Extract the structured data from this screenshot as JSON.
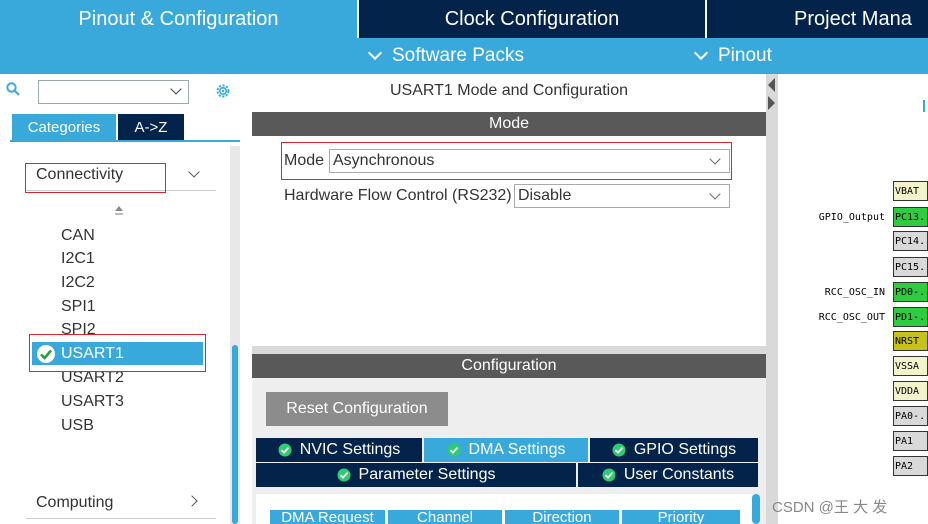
{
  "top_tabs": [
    {
      "label": "Pinout & Configuration"
    },
    {
      "label": "Clock Configuration"
    },
    {
      "label": "Project Mana"
    }
  ],
  "sub_bar": {
    "software_packs": "Software Packs",
    "pinout": "Pinout"
  },
  "left": {
    "search": {
      "value": "",
      "placeholder": ""
    },
    "tabs": {
      "categories": "Categories",
      "az": "A->Z"
    },
    "connectivity": "Connectivity",
    "items": [
      "CAN",
      "I2C1",
      "I2C2",
      "SPI1",
      "SPI2",
      "USART1",
      "USART2",
      "USART3",
      "USB"
    ],
    "selected_item": "USART1",
    "computing": "Computing"
  },
  "middle": {
    "title": "USART1 Mode and Configuration",
    "mode_header": "Mode",
    "mode_label": "Mode",
    "mode_value": "Asynchronous",
    "hfc_label": "Hardware Flow Control (RS232)",
    "hfc_value": "Disable",
    "config_header": "Configuration",
    "reset_button": "Reset Configuration",
    "settings_tabs": {
      "nvic": "NVIC Settings",
      "dma": "DMA Settings",
      "gpio": "GPIO Settings",
      "parameter": "Parameter Settings",
      "user_constants": "User Constants"
    },
    "active_tab": "DMA Settings",
    "table_headers": [
      "DMA Request",
      "Channel",
      "Direction",
      "Priority"
    ]
  },
  "pinout": {
    "pins": [
      {
        "name": "VBAT",
        "color": "#f2f2cc",
        "label": ""
      },
      {
        "name": "PC13.",
        "color": "#2ecc40",
        "label": "GPIO_Output"
      },
      {
        "name": "PC14.",
        "color": "#d9d9d9",
        "label": ""
      },
      {
        "name": "PC15.",
        "color": "#d9d9d9",
        "label": ""
      },
      {
        "name": "PD0-..",
        "color": "#2ecc40",
        "label": "RCC_OSC_IN"
      },
      {
        "name": "PD1-..",
        "color": "#2ecc40",
        "label": "RCC_OSC_OUT"
      },
      {
        "name": "NRST",
        "color": "#c6c21a",
        "label": ""
      },
      {
        "name": "VSSA",
        "color": "#f2f2cc",
        "label": ""
      },
      {
        "name": "VDDA",
        "color": "#f2f2cc",
        "label": ""
      },
      {
        "name": "PA0-..",
        "color": "#d9d9d9",
        "label": ""
      },
      {
        "name": "PA1",
        "color": "#d9d9d9",
        "label": ""
      },
      {
        "name": "PA2",
        "color": "#d9d9d9",
        "label": ""
      }
    ]
  },
  "watermark": "CSDN @王 大 发",
  "colors": {
    "navy": "#03234b",
    "accent": "#39a9dc",
    "highlight_box": "#d9262c"
  }
}
